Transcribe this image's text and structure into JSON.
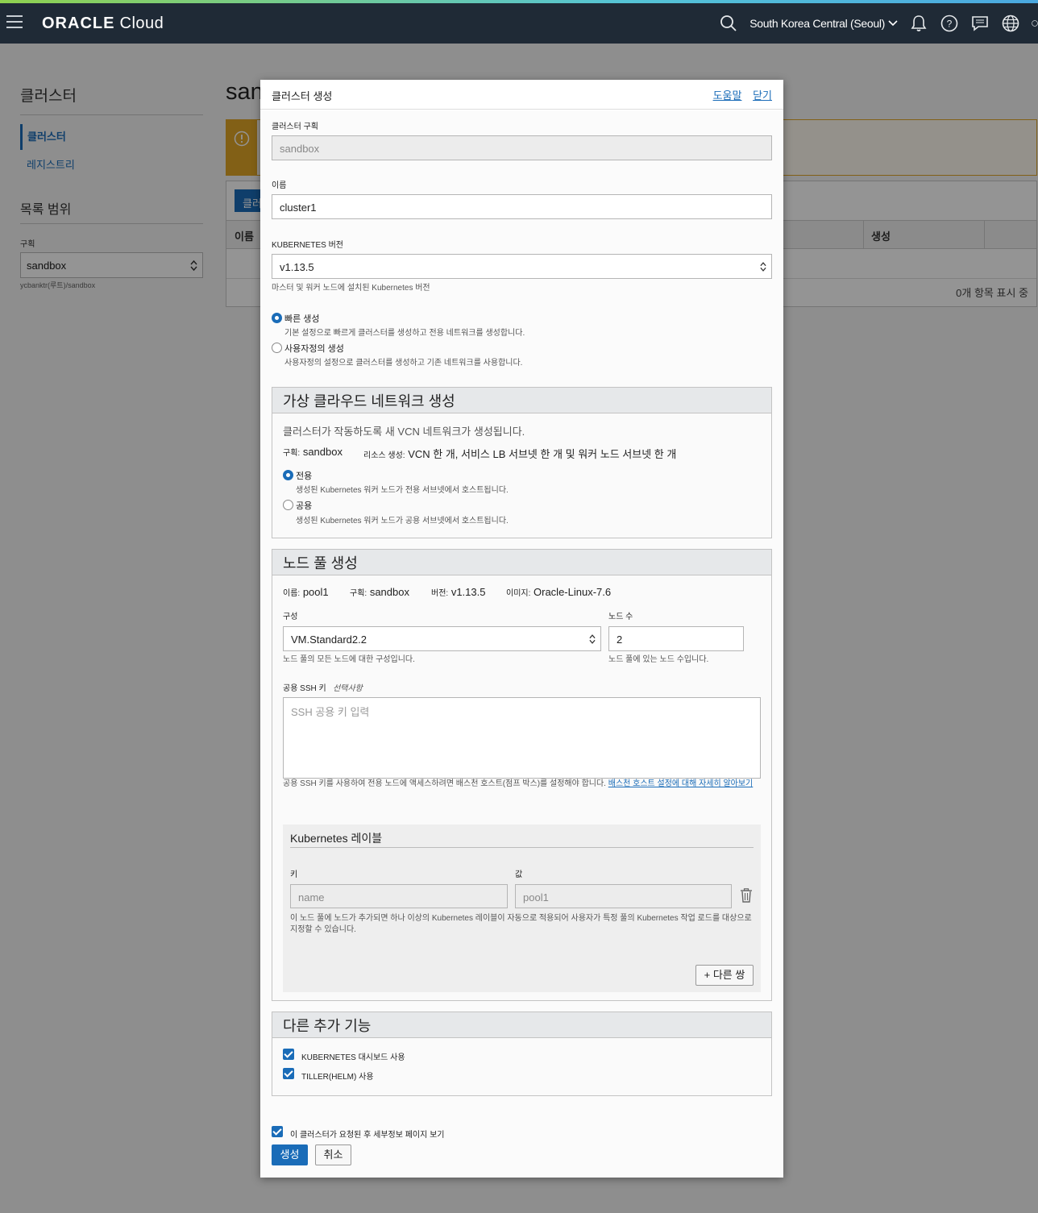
{
  "header": {
    "logo_oracle": "ORACLE",
    "logo_cloud": "Cloud",
    "region": "South Korea Central (Seoul)"
  },
  "sidebar": {
    "title": "클러스터",
    "items": [
      {
        "label": "클러스터",
        "active": true
      },
      {
        "label": "레지스트리",
        "active": false
      }
    ],
    "scope_title": "목록 범위",
    "compartment_label": "구획",
    "compartment_value": "sandbox",
    "compartment_path": "ycbanktr(루트)/sandbox"
  },
  "page": {
    "title": "sandbox",
    "create_button": "클러스터 생성",
    "columns": [
      "이름",
      "생성"
    ],
    "footer": "0개 항목 표시 중"
  },
  "dialog": {
    "title": "클러스터 생성",
    "help_link": "도움말",
    "close_link": "닫기",
    "compartment": {
      "label": "클러스터 구획",
      "value": "sandbox"
    },
    "name": {
      "label": "이름",
      "value": "cluster1"
    },
    "k8s_version": {
      "label": "KUBERNETES 버전",
      "value": "v1.13.5",
      "hint": "마스터 및 워커 노드에 설치된 Kubernetes 버전"
    },
    "creation_mode": {
      "quick": {
        "label": "빠른 생성",
        "hint": "기본 설정으로 빠르게 클러스터를 생성하고 전용 네트워크를 생성합니다.",
        "checked": true
      },
      "custom": {
        "label": "사용자정의 생성",
        "hint": "사용자정의 설정으로 클러스터를 생성하고 기존 네트워크를 사용합니다.",
        "checked": false
      }
    },
    "vcn": {
      "title": "가상 클라우드 네트워크 생성",
      "description": "클러스터가 작동하도록 새 VCN 네트워크가 생성됩니다.",
      "compartment_key": "구획:",
      "compartment_value": "sandbox",
      "resources_key": "리소스 생성:",
      "resources_value": "VCN 한 개, 서비스 LB 서브넷 한 개 및 워커 노드 서브넷 한 개",
      "private": {
        "label": "전용",
        "hint": "생성된 Kubernetes 워커 노드가 전용 서브넷에서 호스트됩니다.",
        "checked": true
      },
      "public": {
        "label": "공용",
        "hint": "생성된 Kubernetes 워커 노드가 공용 서브넷에서 호스트됩니다.",
        "checked": false
      }
    },
    "node_pool": {
      "title": "노드 풀 생성",
      "name_key": "이름:",
      "name_value": "pool1",
      "compartment_key": "구획:",
      "compartment_value": "sandbox",
      "version_key": "버전:",
      "version_value": "v1.13.5",
      "image_key": "이미지:",
      "image_value": "Oracle-Linux-7.6",
      "shape_label": "구성",
      "shape_value": "VM.Standard2.2",
      "shape_hint": "노드 풀의 모든 노드에 대한 구성입니다.",
      "count_label": "노드 수",
      "count_value": "2",
      "count_hint": "노드 풀에 있는 노드 수입니다.",
      "ssh_label": "공용 SSH 키",
      "ssh_optional": "선택사항",
      "ssh_placeholder": "SSH 공용 키 입력",
      "ssh_hint": "공용 SSH 키를 사용하여 전용 노드에 액세스하려면 배스천 호스트(점프 박스)를 설정해야 합니다.",
      "ssh_hint_link": "배스천 호스트 설정에 대해 자세히 알아보기",
      "labels": {
        "title": "Kubernetes 레이블",
        "key_label": "키",
        "value_label": "값",
        "key_value": "name",
        "value_value": "pool1",
        "hint": "이 노드 풀에 노드가 추가되면 하나 이상의 Kubernetes 레이블이 자동으로 적용되어 사용자가 특정 풀의 Kubernetes 작업 로드를 대상으로 지정할 수 있습니다.",
        "add_button": "+ 다른 쌍"
      }
    },
    "addons": {
      "title": "다른 추가 기능",
      "dashboard": {
        "label": "KUBERNETES 대시보드 사용",
        "checked": true
      },
      "tiller": {
        "label": "TILLER(HELM) 사용",
        "checked": true
      }
    },
    "view_details": {
      "label": "이 클러스터가 요청된 후 세부정보 페이지 보기",
      "checked": true
    },
    "create_button": "생성",
    "cancel_button": "취소"
  },
  "colors": {
    "topbar": "#1f2a36",
    "accent": "#1a6cb8",
    "warning": "#e1a526"
  }
}
